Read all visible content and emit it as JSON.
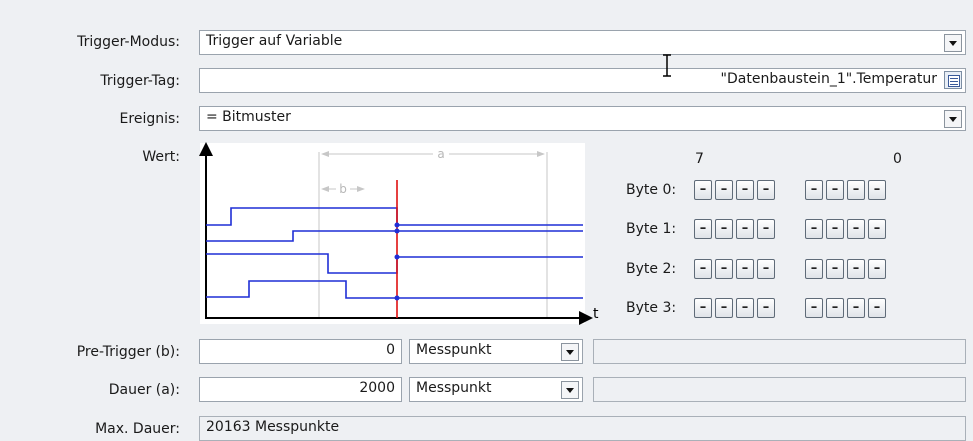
{
  "labels": {
    "trigger_mode": "Trigger-Modus:",
    "trigger_tag": "Trigger-Tag:",
    "event": "Ereignis:",
    "value": "Wert:",
    "pre_trigger": "Pre-Trigger (b):",
    "duration": "Dauer (a):",
    "max_duration": "Max. Dauer:"
  },
  "trigger_mode": {
    "value": "Trigger auf Variable"
  },
  "trigger_tag": {
    "value": "\"Datenbaustein_1\".Temperatur"
  },
  "event": {
    "value": "= Bitmuster"
  },
  "diagram": {
    "a": "a",
    "b": "b",
    "t": "t"
  },
  "bit_header": {
    "high": "7",
    "low": "0"
  },
  "bytes": [
    {
      "label": "Byte 0:",
      "bits": [
        "–",
        "–",
        "–",
        "–",
        "–",
        "–",
        "–",
        "–"
      ]
    },
    {
      "label": "Byte 1:",
      "bits": [
        "–",
        "–",
        "–",
        "–",
        "–",
        "–",
        "–",
        "–"
      ]
    },
    {
      "label": "Byte 2:",
      "bits": [
        "–",
        "–",
        "–",
        "–",
        "–",
        "–",
        "–",
        "–"
      ]
    },
    {
      "label": "Byte 3:",
      "bits": [
        "–",
        "–",
        "–",
        "–",
        "–",
        "–",
        "–",
        "–"
      ]
    }
  ],
  "pre_trigger": {
    "value": "0",
    "unit": "Messpunkt"
  },
  "duration": {
    "value": "2000",
    "unit": "Messpunkt"
  },
  "max_duration": {
    "value": "20163 Messpunkte"
  },
  "colors": {
    "signal": "#1f2fd6",
    "trigger_line": "#e01010",
    "grid": "#c7c7c7"
  },
  "icons": {
    "dropdown": "chevron-down-icon",
    "tag_browse": "list-icon"
  }
}
